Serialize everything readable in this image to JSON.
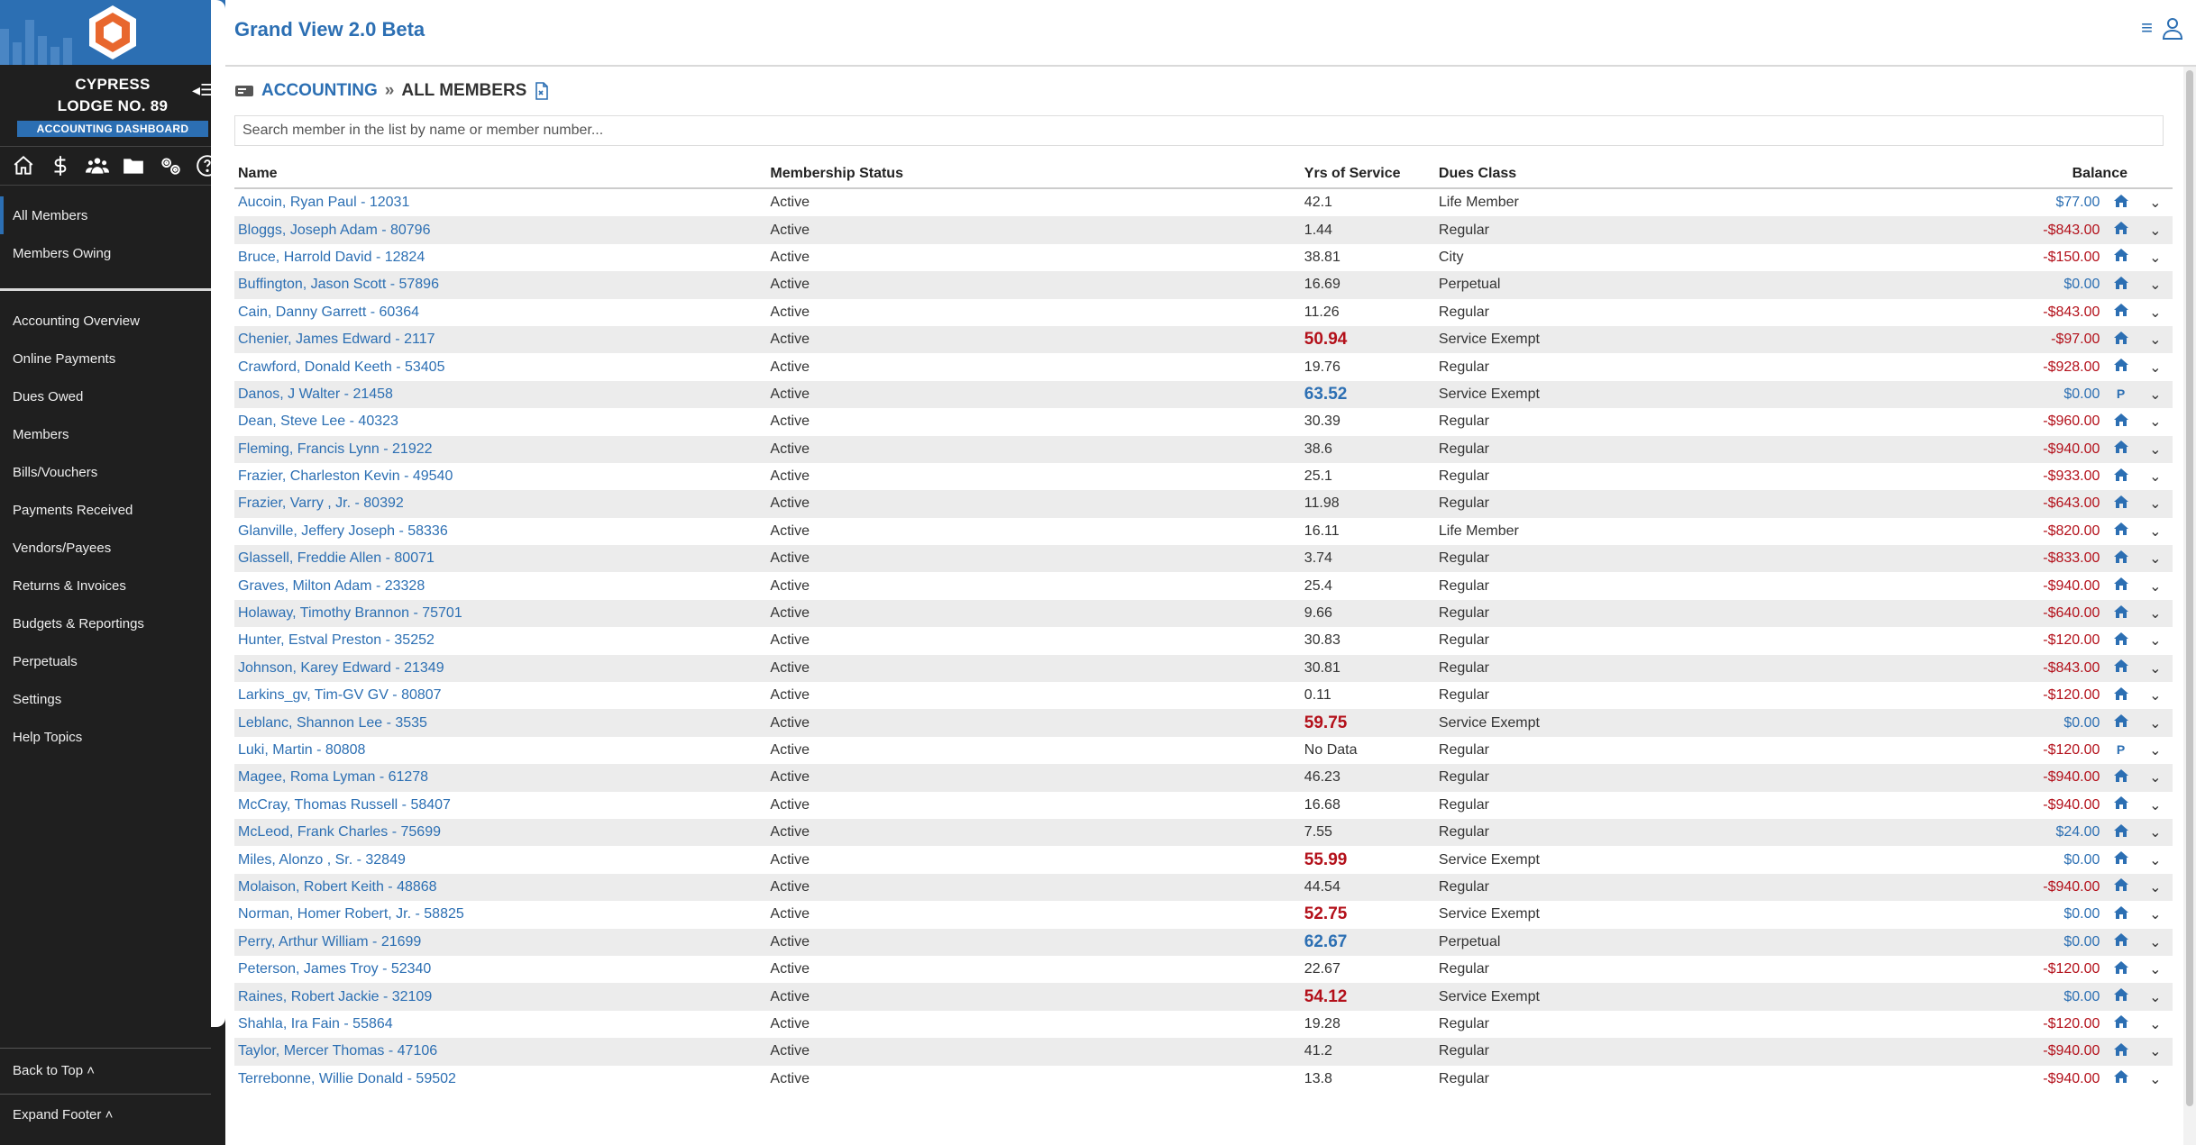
{
  "app": {
    "title": "Grand View 2.0 Beta"
  },
  "lodge": {
    "line1": "CYPRESS",
    "line2": "LODGE NO. 89",
    "badge": "ACCOUNTING DASHBOARD"
  },
  "icons": [
    "home-icon",
    "dollar-icon",
    "members-icon",
    "folder-icon",
    "settings-icon",
    "help-icon"
  ],
  "nav": {
    "top": [
      {
        "label": "All Members"
      },
      {
        "label": "Members Owing"
      }
    ],
    "main": [
      {
        "label": "Accounting Overview"
      },
      {
        "label": "Online Payments"
      },
      {
        "label": "Dues Owed"
      },
      {
        "label": "Members"
      },
      {
        "label": "Bills/Vouchers"
      },
      {
        "label": "Payments Received"
      },
      {
        "label": "Vendors/Payees"
      },
      {
        "label": "Returns & Invoices"
      },
      {
        "label": "Budgets & Reportings"
      },
      {
        "label": "Perpetuals"
      },
      {
        "label": "Settings"
      },
      {
        "label": "Help Topics"
      }
    ],
    "bottom": {
      "back_to_top": "Back to Top",
      "expand_footer": "Expand Footer"
    }
  },
  "breadcrumb": {
    "section": "ACCOUNTING",
    "page": "ALL MEMBERS"
  },
  "search": {
    "placeholder": "Search member in the list by name or member number..."
  },
  "table": {
    "headers": {
      "name": "Name",
      "status": "Membership Status",
      "yrs": "Yrs of Service",
      "dues": "Dues Class",
      "balance": "Balance"
    },
    "rows": [
      {
        "name": "Aucoin, Ryan Paul - 12031",
        "status": "Active",
        "yrs": "42.1",
        "dues": "Life Member",
        "balance": "$77.00",
        "sign": "pos",
        "flag": "home"
      },
      {
        "name": "Bloggs, Joseph Adam - 80796",
        "status": "Active",
        "yrs": "1.44",
        "dues": "Regular",
        "balance": "-$843.00",
        "sign": "neg",
        "flag": "home"
      },
      {
        "name": "Bruce, Harrold David - 12824",
        "status": "Active",
        "yrs": "38.81",
        "dues": "City",
        "balance": "-$150.00",
        "sign": "neg",
        "flag": "home"
      },
      {
        "name": "Buffington, Jason Scott - 57896",
        "status": "Active",
        "yrs": "16.69",
        "dues": "Perpetual",
        "balance": "$0.00",
        "sign": "pos",
        "flag": "home"
      },
      {
        "name": "Cain, Danny Garrett - 60364",
        "status": "Active",
        "yrs": "11.26",
        "dues": "Regular",
        "balance": "-$843.00",
        "sign": "neg",
        "flag": "home"
      },
      {
        "name": "Chenier, James Edward - 2117",
        "status": "Active",
        "yrs": "50.94",
        "yrs_style": "red",
        "dues": "Service Exempt",
        "balance": "-$97.00",
        "sign": "neg",
        "flag": "home"
      },
      {
        "name": "Crawford, Donald Keeth - 53405",
        "status": "Active",
        "yrs": "19.76",
        "dues": "Regular",
        "balance": "-$928.00",
        "sign": "neg",
        "flag": "home"
      },
      {
        "name": "Danos, J Walter - 21458",
        "status": "Active",
        "yrs": "63.52",
        "yrs_style": "blue",
        "dues": "Service Exempt",
        "balance": "$0.00",
        "sign": "pos",
        "flag": "P"
      },
      {
        "name": "Dean, Steve Lee - 40323",
        "status": "Active",
        "yrs": "30.39",
        "dues": "Regular",
        "balance": "-$960.00",
        "sign": "neg",
        "flag": "home"
      },
      {
        "name": "Fleming, Francis Lynn - 21922",
        "status": "Active",
        "yrs": "38.6",
        "dues": "Regular",
        "balance": "-$940.00",
        "sign": "neg",
        "flag": "home"
      },
      {
        "name": "Frazier, Charleston Kevin - 49540",
        "status": "Active",
        "yrs": "25.1",
        "dues": "Regular",
        "balance": "-$933.00",
        "sign": "neg",
        "flag": "home"
      },
      {
        "name": "Frazier, Varry , Jr. - 80392",
        "status": "Active",
        "yrs": "11.98",
        "dues": "Regular",
        "balance": "-$643.00",
        "sign": "neg",
        "flag": "home"
      },
      {
        "name": "Glanville, Jeffery Joseph - 58336",
        "status": "Active",
        "yrs": "16.11",
        "dues": "Life Member",
        "balance": "-$820.00",
        "sign": "neg",
        "flag": "home"
      },
      {
        "name": "Glassell, Freddie Allen - 80071",
        "status": "Active",
        "yrs": "3.74",
        "dues": "Regular",
        "balance": "-$833.00",
        "sign": "neg",
        "flag": "home"
      },
      {
        "name": "Graves, Milton Adam - 23328",
        "status": "Active",
        "yrs": "25.4",
        "dues": "Regular",
        "balance": "-$940.00",
        "sign": "neg",
        "flag": "home"
      },
      {
        "name": "Holaway, Timothy Brannon - 75701",
        "status": "Active",
        "yrs": "9.66",
        "dues": "Regular",
        "balance": "-$640.00",
        "sign": "neg",
        "flag": "home"
      },
      {
        "name": "Hunter, Estval Preston - 35252",
        "status": "Active",
        "yrs": "30.83",
        "dues": "Regular",
        "balance": "-$120.00",
        "sign": "neg",
        "flag": "home"
      },
      {
        "name": "Johnson, Karey Edward - 21349",
        "status": "Active",
        "yrs": "30.81",
        "dues": "Regular",
        "balance": "-$843.00",
        "sign": "neg",
        "flag": "home"
      },
      {
        "name": "Larkins_gv, Tim-GV GV - 80807",
        "status": "Active",
        "yrs": "0.11",
        "dues": "Regular",
        "balance": "-$120.00",
        "sign": "neg",
        "flag": "home"
      },
      {
        "name": "Leblanc, Shannon Lee - 3535",
        "status": "Active",
        "yrs": "59.75",
        "yrs_style": "red",
        "dues": "Service Exempt",
        "balance": "$0.00",
        "sign": "pos",
        "flag": "home"
      },
      {
        "name": "Luki, Martin - 80808",
        "status": "Active",
        "yrs": "No Data",
        "dues": "Regular",
        "balance": "-$120.00",
        "sign": "neg",
        "flag": "P"
      },
      {
        "name": "Magee, Roma Lyman - 61278",
        "status": "Active",
        "yrs": "46.23",
        "dues": "Regular",
        "balance": "-$940.00",
        "sign": "neg",
        "flag": "home"
      },
      {
        "name": "McCray, Thomas Russell - 58407",
        "status": "Active",
        "yrs": "16.68",
        "dues": "Regular",
        "balance": "-$940.00",
        "sign": "neg",
        "flag": "home"
      },
      {
        "name": "McLeod, Frank Charles - 75699",
        "status": "Active",
        "yrs": "7.55",
        "dues": "Regular",
        "balance": "$24.00",
        "sign": "pos",
        "flag": "home"
      },
      {
        "name": "Miles, Alonzo , Sr. - 32849",
        "status": "Active",
        "yrs": "55.99",
        "yrs_style": "red",
        "dues": "Service Exempt",
        "balance": "$0.00",
        "sign": "pos",
        "flag": "home"
      },
      {
        "name": "Molaison, Robert Keith - 48868",
        "status": "Active",
        "yrs": "44.54",
        "dues": "Regular",
        "balance": "-$940.00",
        "sign": "neg",
        "flag": "home"
      },
      {
        "name": "Norman, Homer Robert, Jr. - 58825",
        "status": "Active",
        "yrs": "52.75",
        "yrs_style": "red",
        "dues": "Service Exempt",
        "balance": "$0.00",
        "sign": "pos",
        "flag": "home"
      },
      {
        "name": "Perry, Arthur William - 21699",
        "status": "Active",
        "yrs": "62.67",
        "yrs_style": "blue",
        "dues": "Perpetual",
        "balance": "$0.00",
        "sign": "pos",
        "flag": "home"
      },
      {
        "name": "Peterson, James Troy - 52340",
        "status": "Active",
        "yrs": "22.67",
        "dues": "Regular",
        "balance": "-$120.00",
        "sign": "neg",
        "flag": "home"
      },
      {
        "name": "Raines, Robert Jackie - 32109",
        "status": "Active",
        "yrs": "54.12",
        "yrs_style": "red",
        "dues": "Service Exempt",
        "balance": "$0.00",
        "sign": "pos",
        "flag": "home"
      },
      {
        "name": "Shahla, Ira Fain - 55864",
        "status": "Active",
        "yrs": "19.28",
        "dues": "Regular",
        "balance": "-$120.00",
        "sign": "neg",
        "flag": "home"
      },
      {
        "name": "Taylor, Mercer Thomas - 47106",
        "status": "Active",
        "yrs": "41.2",
        "dues": "Regular",
        "balance": "-$940.00",
        "sign": "neg",
        "flag": "home"
      },
      {
        "name": "Terrebonne, Willie Donald - 59502",
        "status": "Active",
        "yrs": "13.8",
        "dues": "Regular",
        "balance": "-$940.00",
        "sign": "neg",
        "flag": "home"
      }
    ]
  },
  "colors": {
    "brand": "#2c6fb3",
    "negative": "#b3101a",
    "sidebar": "#1f1f1f"
  }
}
